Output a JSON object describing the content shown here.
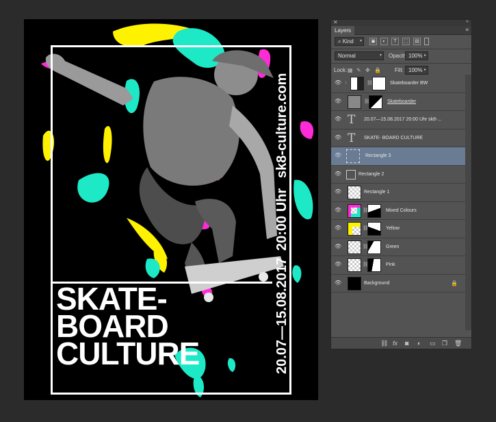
{
  "poster": {
    "title_lines": [
      "SKATE-",
      "BOARD",
      "CULTURE"
    ],
    "dates": "20.07—15.08.2017",
    "time": "20:00 Uhr",
    "url": "sk8-culture.com",
    "colors": {
      "magenta": "#ff2bd6",
      "yellow": "#fff200",
      "cyan": "#1de9c7",
      "background": "#000000",
      "text": "#ffffff"
    }
  },
  "panel": {
    "tab_label": "Layers",
    "kind_label": "Kind",
    "blend_mode": "Normal",
    "opacity_label": "Opacity:",
    "opacity_value": "100%",
    "lock_label": "Lock:",
    "fill_label": "Fill:",
    "fill_value": "100%",
    "layers": [
      {
        "name": "Skateboarder BW",
        "type": "adjustment"
      },
      {
        "name": "Skateboarder",
        "type": "image-with-mask"
      },
      {
        "name": "20.07—15.08.2017      20:00 Uhr      sk8-...",
        "type": "text"
      },
      {
        "name": "SKATE- BOARD CULTURE",
        "type": "text"
      },
      {
        "name": "Rectangle 3",
        "type": "shape",
        "selected": true
      },
      {
        "name": "Rectangle 2",
        "type": "shape"
      },
      {
        "name": "Rectangle 1",
        "type": "shape"
      },
      {
        "name": "Mixed Colours",
        "type": "image-with-mask"
      },
      {
        "name": "Yellow",
        "type": "image-with-mask"
      },
      {
        "name": "Green",
        "type": "image-with-mask"
      },
      {
        "name": "Pink",
        "type": "image-with-mask"
      },
      {
        "name": "Background",
        "type": "background",
        "locked": true
      }
    ],
    "icons": [
      "eye-icon",
      "link-icon",
      "lock-icon",
      "fx-icon",
      "mask-icon",
      "adjustment-icon",
      "folder-icon",
      "new-layer-icon",
      "trash-icon"
    ]
  }
}
